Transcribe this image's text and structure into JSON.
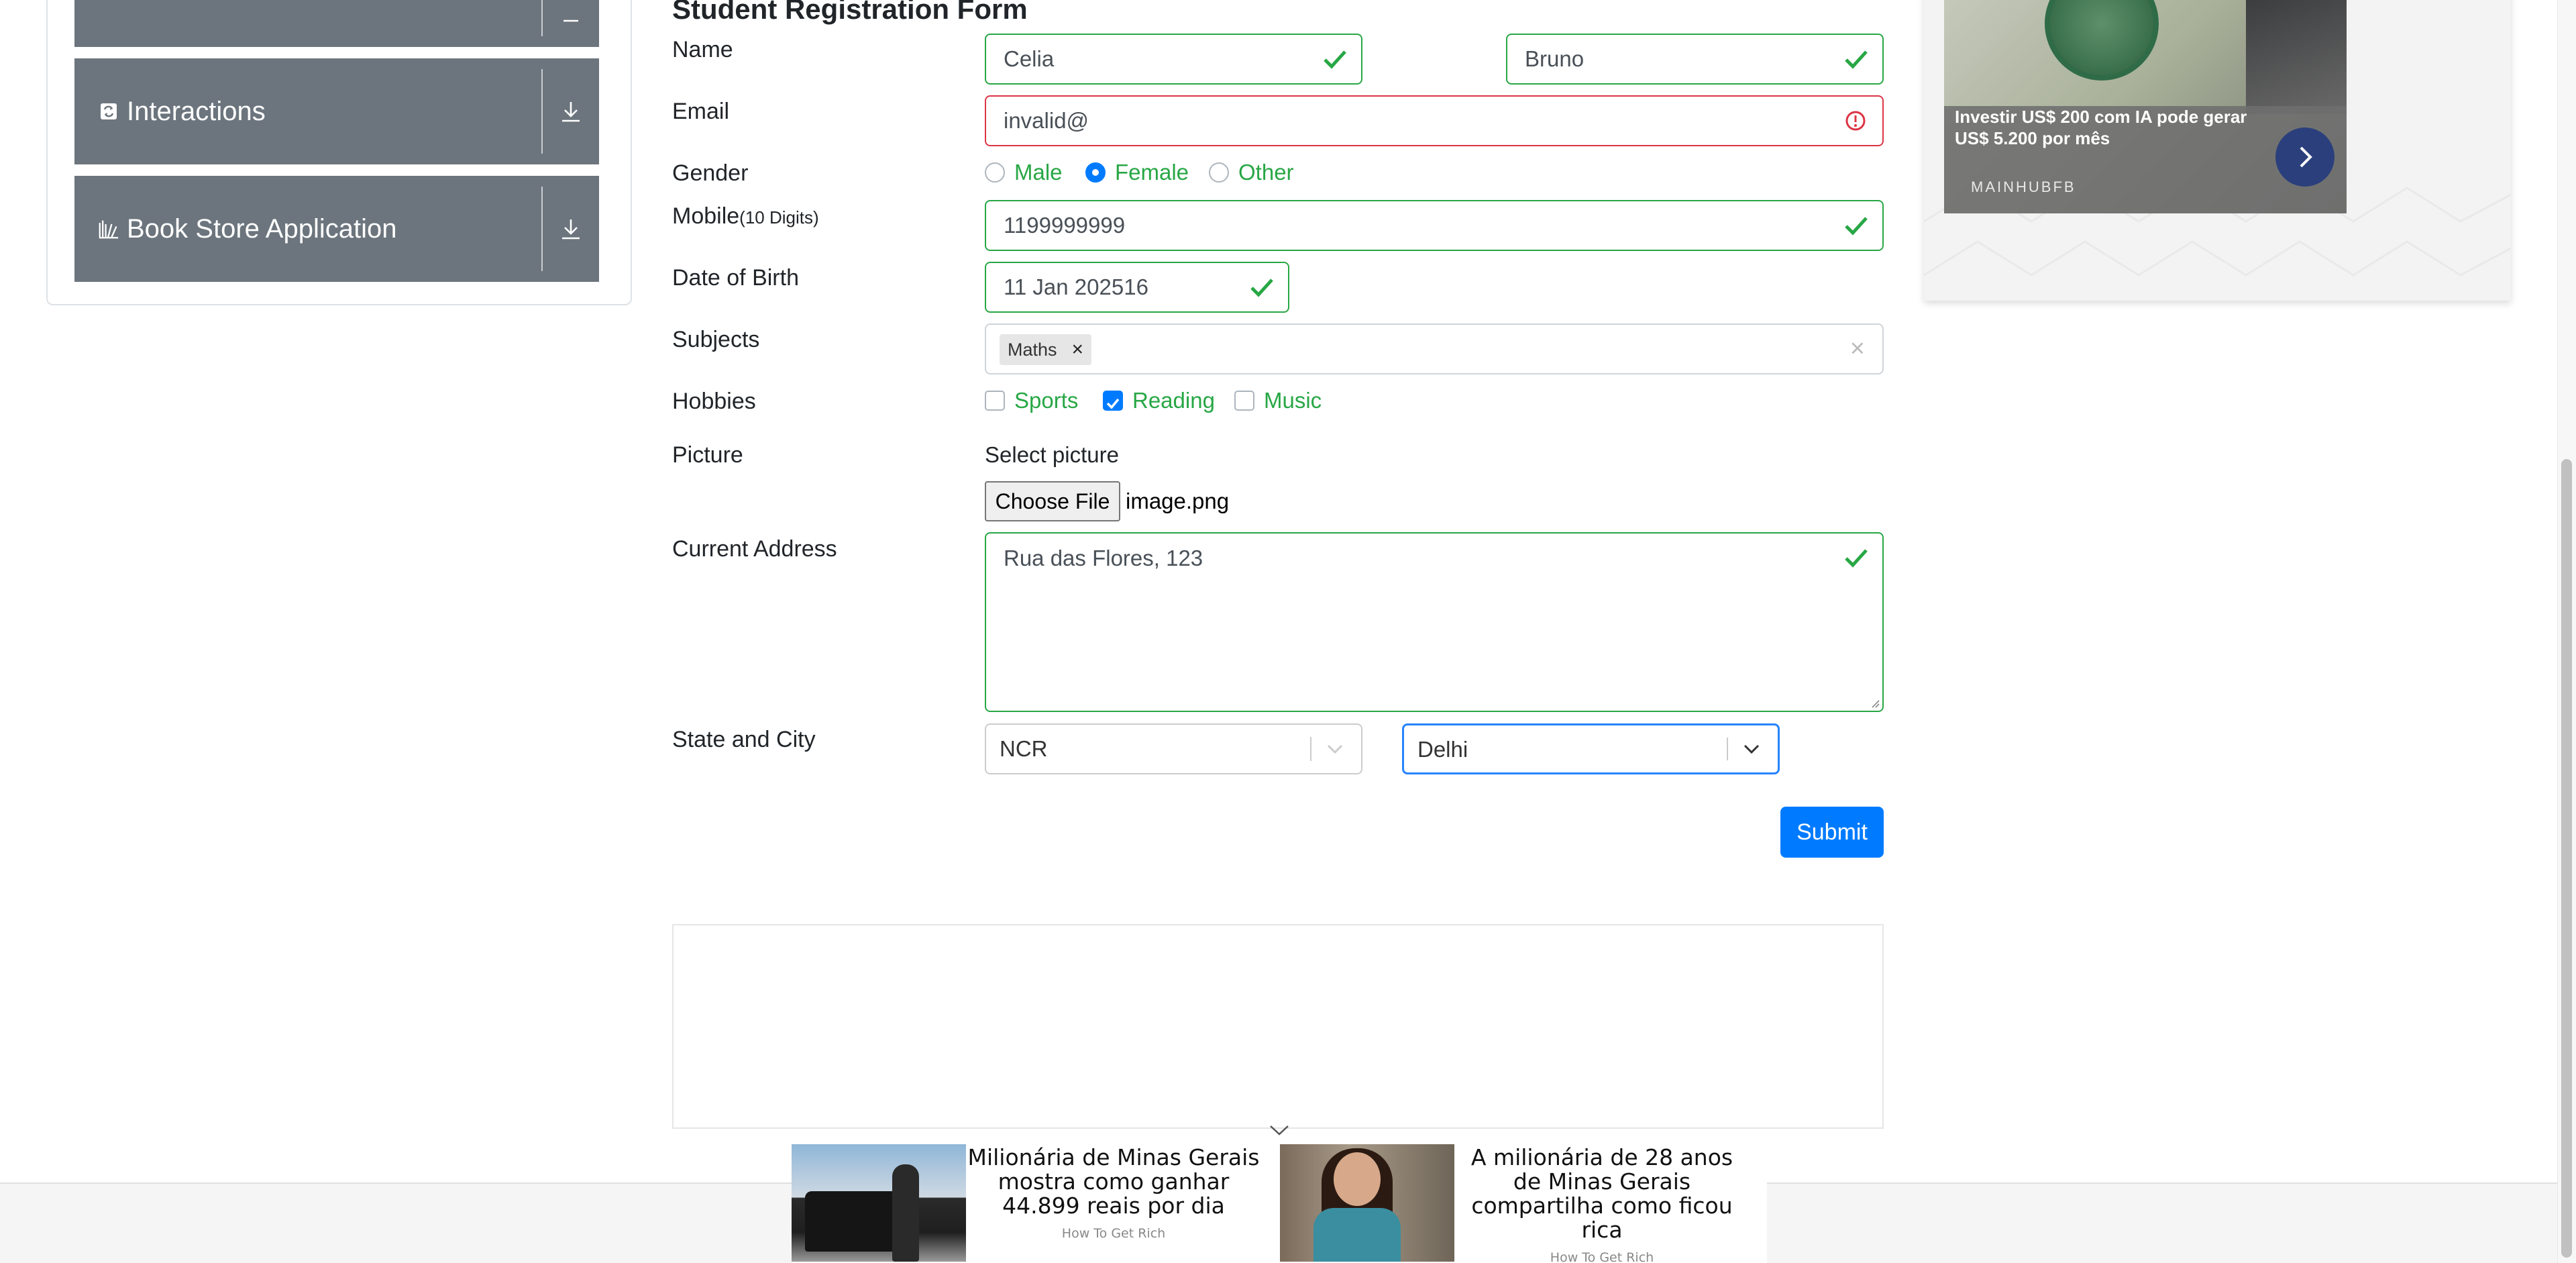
{
  "sidebar": {
    "groups": [
      {
        "label": "Interactions",
        "icon": "interactions-icon"
      },
      {
        "label": "Book Store Application",
        "icon": "book-store-icon"
      }
    ],
    "expand_icon": "download-arrow-icon"
  },
  "form": {
    "title": "Student Registration Form",
    "name_label": "Name",
    "first_name": "Celia",
    "last_name": "Bruno",
    "email_label": "Email",
    "email_value": "invalid@",
    "gender_label": "Gender",
    "gender_options": [
      "Male",
      "Female",
      "Other"
    ],
    "gender_selected": "Female",
    "mobile_label": "Mobile",
    "mobile_hint": "(10 Digits)",
    "mobile_value": "1199999999",
    "dob_label": "Date of Birth",
    "dob_value": "11 Jan 202516",
    "subjects_label": "Subjects",
    "subjects": [
      "Maths"
    ],
    "subject_remove_symbol": "×",
    "subjects_clear_symbol": "×",
    "hobbies_label": "Hobbies",
    "hobbies": [
      "Sports",
      "Reading",
      "Music"
    ],
    "hobbies_checked": [
      "Reading"
    ],
    "picture_label": "Picture",
    "picture_select_label": "Select picture",
    "choose_file_label": "Choose File",
    "picture_file": "image.png",
    "address_label": "Current Address",
    "address_value": "Rua das Flores, 123",
    "state_city_label": "State and City",
    "state_value": "NCR",
    "city_value": "Delhi",
    "submit_label": "Submit"
  },
  "colors": {
    "valid": "#28a745",
    "invalid": "#dc3545",
    "primary": "#007bff",
    "sidebar_header": "#6c757d"
  },
  "right_ad": {
    "text": "Investir US$ 200 com IA pode gerar US$ 5.200 por mês",
    "brand": "MAINHUBFB"
  },
  "bottom_ads": [
    {
      "headline": "Milionária de Minas Gerais mostra como ganhar 44.899 reais por dia",
      "source": "How To Get Rich"
    },
    {
      "headline": "A milionária de 28 anos de Minas Gerais compartilha como ficou rica",
      "source": "How To Get Rich"
    }
  ]
}
